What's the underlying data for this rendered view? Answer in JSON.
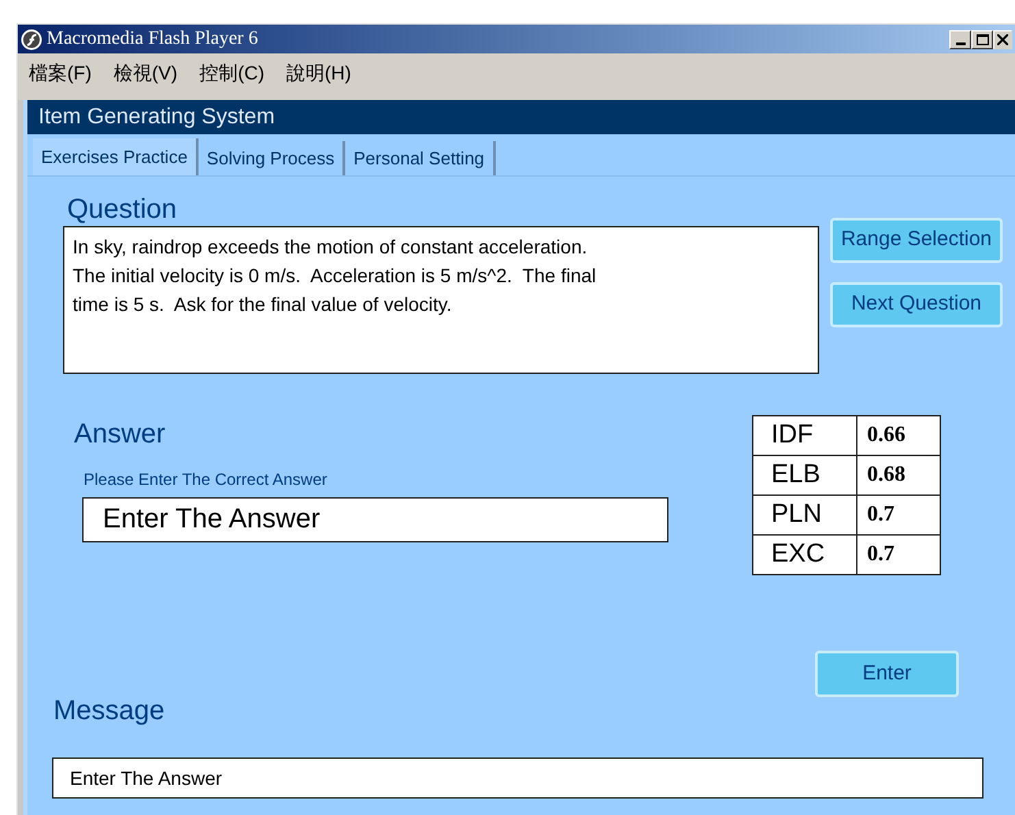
{
  "window": {
    "title": "Macromedia Flash Player 6"
  },
  "menu": [
    "檔案(F)",
    "檢視(V)",
    "控制(C)",
    "說明(H)"
  ],
  "app_title": "Item Generating System",
  "tabs": [
    {
      "label": "Exercises Practice",
      "selected": true
    },
    {
      "label": "Solving Process",
      "selected": false
    },
    {
      "label": "Personal Setting",
      "selected": false
    }
  ],
  "question": {
    "heading": "Question",
    "lines": [
      "In sky, raindrop exceeds the motion of constant acceleration.",
      "The initial velocity is 0 m/s.  Acceleration is 5 m/s^2.  The final",
      "time is 5 s.  Ask for the final value of velocity."
    ]
  },
  "side_buttons": [
    "Range Selection",
    "Next Question"
  ],
  "answer": {
    "heading": "Answer",
    "label": "Please Enter The Correct Answer",
    "value": "Enter The Answer"
  },
  "scores": [
    {
      "name": "IDF",
      "value": "0.66"
    },
    {
      "name": "ELB",
      "value": "0.68"
    },
    {
      "name": "PLN",
      "value": "0.7"
    },
    {
      "name": "EXC",
      "value": "0.7"
    }
  ],
  "enter_button": "Enter",
  "message": {
    "heading": "Message",
    "value": "Enter The Answer"
  }
}
